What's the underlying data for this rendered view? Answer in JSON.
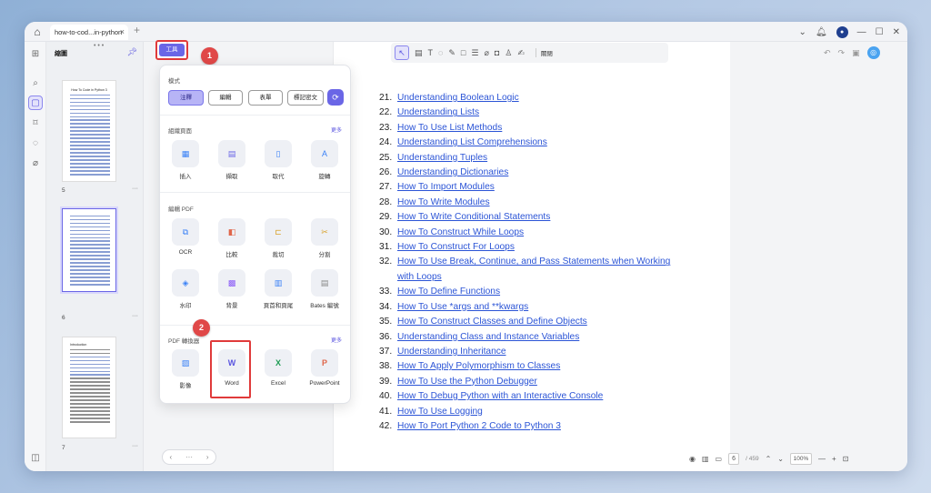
{
  "window": {
    "tab_title": "how-to-cod...in-python",
    "tab_close": "×",
    "new_tab": "+"
  },
  "thumbnails": {
    "title": "縮圖",
    "pages": [
      {
        "number": "5",
        "heading": "How To Code in Python 3"
      },
      {
        "number": "6",
        "heading": ""
      },
      {
        "number": "7",
        "heading": "Introduction"
      }
    ]
  },
  "tools_button": {
    "label": "工具"
  },
  "badges": [
    "1",
    "2"
  ],
  "popup": {
    "mode_title": "模式",
    "modes": [
      "注釋",
      "編輯",
      "表單",
      "標記密文"
    ],
    "organize_title": "組織頁面",
    "organize_more": "更多",
    "organize_tools": [
      "插入",
      "擷取",
      "取代",
      "旋轉"
    ],
    "edit_title": "編輯 PDF",
    "edit_tools": [
      "OCR",
      "比較",
      "裁切",
      "分割",
      "水印",
      "背景",
      "頁首和頁尾",
      "Bates 編號"
    ],
    "convert_title": "PDF 轉換器",
    "convert_more": "更多",
    "convert_tools": [
      "影像",
      "Word",
      "Excel",
      "PowerPoint"
    ]
  },
  "toolbar": {
    "close_label": "關閉"
  },
  "toc": [
    {
      "n": "21.",
      "t": "Understanding Boolean Logic"
    },
    {
      "n": "22.",
      "t": "Understanding Lists"
    },
    {
      "n": "23.",
      "t": "How To Use List Methods"
    },
    {
      "n": "24.",
      "t": "Understanding List Comprehensions"
    },
    {
      "n": "25.",
      "t": "Understanding Tuples"
    },
    {
      "n": "26.",
      "t": "Understanding Dictionaries"
    },
    {
      "n": "27.",
      "t": "How To Import Modules"
    },
    {
      "n": "28.",
      "t": "How To Write Modules"
    },
    {
      "n": "29.",
      "t": "How To Write Conditional Statements"
    },
    {
      "n": "30.",
      "t": "How To Construct While Loops"
    },
    {
      "n": "31.",
      "t": "How To Construct For Loops"
    },
    {
      "n": "32.",
      "t": "How To Use Break, Continue, and Pass Statements when Working"
    },
    {
      "n": "",
      "t": "with Loops"
    },
    {
      "n": "33.",
      "t": "How To Define Functions"
    },
    {
      "n": "34.",
      "t": "How To Use *args and **kwargs"
    },
    {
      "n": "35.",
      "t": "How To Construct Classes and Define Objects"
    },
    {
      "n": "36.",
      "t": "Understanding Class and Instance Variables"
    },
    {
      "n": "37.",
      "t": "Understanding Inheritance"
    },
    {
      "n": "38.",
      "t": "How To Apply Polymorphism to Classes"
    },
    {
      "n": "39.",
      "t": "How To Use the Python Debugger"
    },
    {
      "n": "40.",
      "t": "How To Debug Python with an Interactive Console"
    },
    {
      "n": "41.",
      "t": "How To Use Logging"
    },
    {
      "n": "42.",
      "t": "How To Port Python 2 Code to Python 3"
    }
  ],
  "statusbar": {
    "page_current": "6",
    "page_total": "/ 459",
    "zoom": "100%"
  },
  "colors": {
    "accent": "#6a66e6",
    "highlight": "#e03a3a",
    "link": "#2b54d6"
  }
}
